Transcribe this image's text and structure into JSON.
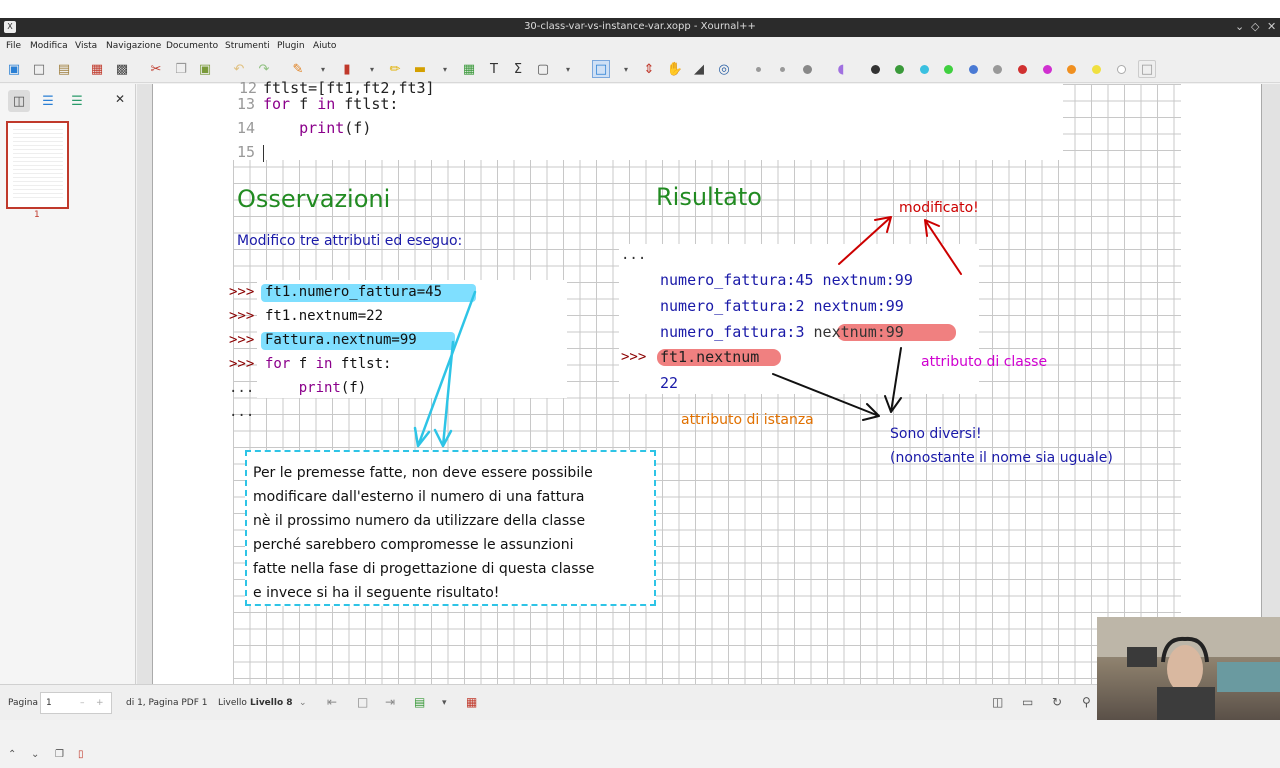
{
  "window": {
    "app_icon": "X",
    "title": "30-class-var-vs-instance-var.xopp - Xournal++",
    "controls": [
      "⌄",
      "◇",
      "✕"
    ]
  },
  "menu": [
    "File",
    "Modifica",
    "Vista",
    "Navigazione",
    "Documento",
    "Strumenti",
    "Plugin",
    "Aiuto"
  ],
  "sidebar": {
    "page_number": "1"
  },
  "code_top": {
    "lines": [
      {
        "num": "13",
        "text": "for f in ftlst:"
      },
      {
        "num": "14",
        "text": "    print(f)"
      },
      {
        "num": "15",
        "text": ""
      }
    ]
  },
  "observations": {
    "heading": "Osservazioni",
    "intro": "Modifico tre attributi ed eseguo:",
    "prompt": ">>>",
    "cont": "...",
    "lines": [
      {
        "prompt": ">>>",
        "text": "ft1.numero_fattura=45"
      },
      {
        "prompt": ">>>",
        "text": "ft1.nextnum=22"
      },
      {
        "prompt": ">>>",
        "text": "Fattura.nextnum=99"
      },
      {
        "prompt": ">>>",
        "text": "for f in ftlst:"
      },
      {
        "prompt": "...",
        "text": "    print(f)"
      },
      {
        "prompt": "...",
        "text": ""
      }
    ]
  },
  "result": {
    "heading": "Risultato",
    "ellipsis": "...",
    "lines": [
      "numero_fattura:45 nextnum:99",
      "numero_fattura:2 nextnum:99",
      "numero_fattura:3 nextnum:99"
    ],
    "lines_prefix_3": "numero_fattura:3 ",
    "lines_highlight_3": "nextnum:99",
    "prompt": ">>>",
    "query": "ft1.nextnum",
    "value": "22"
  },
  "annotations": {
    "modified": "modificato!",
    "class_attr": "attributo di classe",
    "instance_attr": "attributo di istanza",
    "different_1": "Sono diversi!",
    "different_2": "(nonostante il nome sia uguale)"
  },
  "note_box": {
    "lines": [
      "Per le premesse fatte, non deve essere possibile",
      "modificare dall'esterno il numero di una fattura",
      "nè il prossimo numero da utilizzare della classe",
      "perché sarebbero compromesse le assunzioni",
      "fatte nella fase di progettazione di questa classe",
      "e invece si ha il seguente risultato!"
    ]
  },
  "statusbar": {
    "page_label": "Pagina",
    "page_value": "1",
    "of_pages": "di 1, Pagina PDF 1",
    "layer_label": "Livello",
    "layer_value": "Livello 8"
  },
  "colors": {
    "green_heading": "#228b22",
    "cyan_highlight": "#7fdfff",
    "red_highlight": "#f08080",
    "note_border": "#2ec4e6",
    "annotation_red": "#cc0000",
    "annotation_magenta": "#d000d0",
    "annotation_orange": "#e07000",
    "annotation_blue": "#1a1aa8"
  }
}
